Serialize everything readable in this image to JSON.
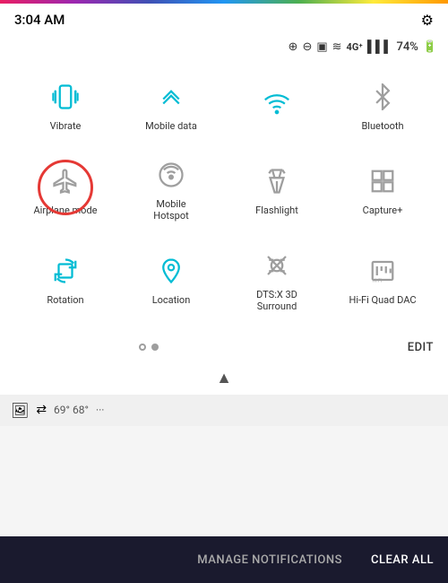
{
  "statusBar": {
    "time": "3:04 AM",
    "battery": "74%",
    "signal": "4G",
    "networkIcons": "⊕ ⊖ ▣ ≋ 4G⁺ ‖‖"
  },
  "quickSettings": {
    "items": [
      {
        "id": "vibrate",
        "label": "Vibrate",
        "active": true
      },
      {
        "id": "mobile-data",
        "label": "Mobile data",
        "active": true
      },
      {
        "id": "wifi",
        "label": "",
        "active": true
      },
      {
        "id": "bluetooth",
        "label": "Bluetooth",
        "active": false
      },
      {
        "id": "airplane",
        "label": "Airplane mode",
        "active": false,
        "circled": true
      },
      {
        "id": "mobile-hotspot",
        "label": "Mobile\nHotspot",
        "active": false
      },
      {
        "id": "flashlight",
        "label": "Flashlight",
        "active": false
      },
      {
        "id": "capture",
        "label": "Capture+",
        "active": false
      },
      {
        "id": "rotation",
        "label": "Rotation",
        "active": true
      },
      {
        "id": "location",
        "label": "Location",
        "active": true
      },
      {
        "id": "dts",
        "label": "DTS:X 3D\nSurround",
        "active": false
      },
      {
        "id": "hifi",
        "label": "Hi-Fi Quad DAC",
        "active": false
      }
    ]
  },
  "pagination": {
    "editLabel": "EDIT",
    "currentPage": 1,
    "totalPages": 2
  },
  "notification": {
    "temperature": "69° 68°",
    "moreLabel": "···"
  },
  "bottomBar": {
    "manageLabel": "MANAGE NOTIFICATIONS",
    "clearLabel": "CLEAR ALL"
  }
}
